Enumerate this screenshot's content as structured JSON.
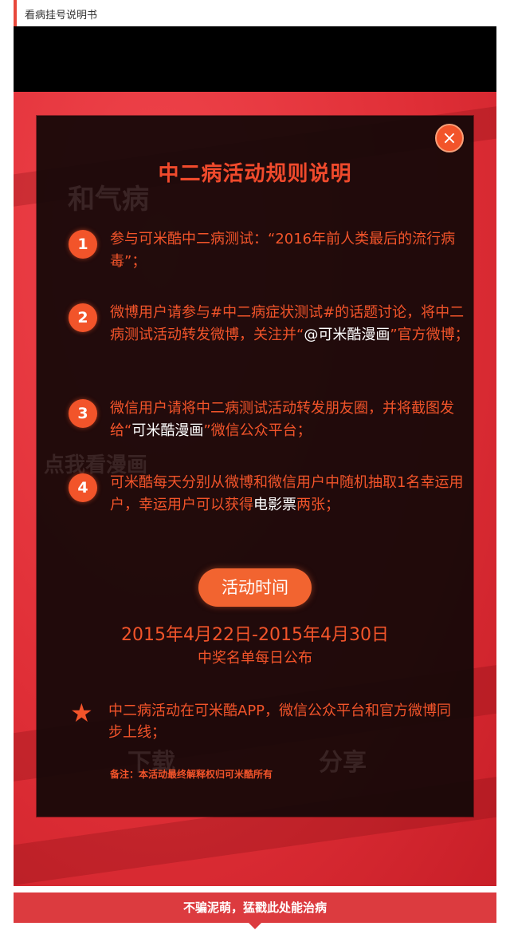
{
  "header": {
    "title": "看病挂号说明书"
  },
  "modal": {
    "close_symbol": "×",
    "title": "中二病活动规则说明",
    "rules": [
      {
        "num": "1",
        "text": "参与可米酷中二病测试：“2016年前人类最后的流行病毒”；"
      },
      {
        "num": "2",
        "text_a": "微博用户请参与#中二病症状测试#的话题讨论，将中二病测试活动转发微博，关注并“",
        "text_hl": "@可米酷漫画",
        "text_b": "”官方微博；"
      },
      {
        "num": "3",
        "text_a": "微信用户请将中二病测试活动转发朋友圈，并将截图发给“",
        "text_hl": "可米酷漫画",
        "text_b": "”微信公众平台；"
      },
      {
        "num": "4",
        "text_a": "可米酷每天分别从微博和微信用户中随机抽取1名幸运用户，幸运用户可以获得",
        "text_hl": "电影票",
        "text_b": "两张；"
      }
    ],
    "time_button": "活动时间",
    "date_range": "2015年4月22日-2015年4月30日",
    "publish_note": "中奖名单每日公布",
    "star_text": "中二病活动在可米酷APP，微信公众平台和官方微博同步上线；",
    "footnote": "备注：本活动最终解释权归可米酷所有"
  },
  "background_ghost": {
    "line1": "和气病",
    "line2": "点我看漫画",
    "line3": "下载",
    "line4": "分享"
  },
  "footer": {
    "text": "不骗泥萌，猛戳此处能治病"
  },
  "colors": {
    "accent": "#f2542a",
    "red_bg": "#e02f37",
    "footer": "#dc3b3f"
  }
}
